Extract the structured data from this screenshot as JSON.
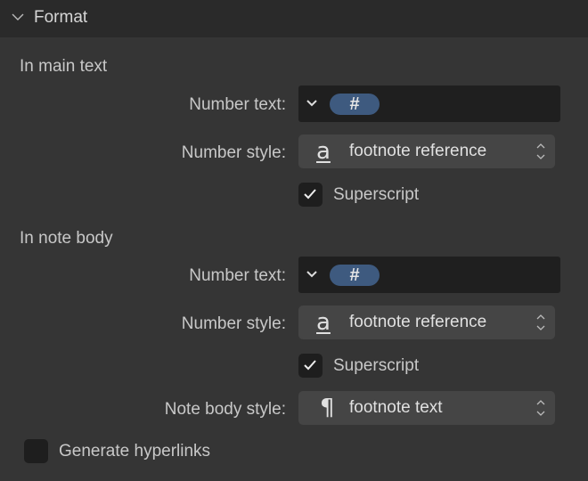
{
  "header": {
    "title": "Format"
  },
  "main_text": {
    "heading": "In main text",
    "number_text_label": "Number text:",
    "number_token": "#",
    "number_style_label": "Number style:",
    "number_style_value": "footnote reference",
    "superscript_label": "Superscript",
    "superscript_checked": true
  },
  "note_body": {
    "heading": "In note body",
    "number_text_label": "Number text:",
    "number_token": "#",
    "number_style_label": "Number style:",
    "number_style_value": "footnote reference",
    "superscript_label": "Superscript",
    "superscript_checked": true,
    "body_style_label": "Note body style:",
    "body_style_value": "footnote text"
  },
  "hyperlinks": {
    "label": "Generate hyperlinks",
    "checked": false
  },
  "icons": {
    "style_glyph": "a",
    "paragraph_glyph": "¶"
  }
}
